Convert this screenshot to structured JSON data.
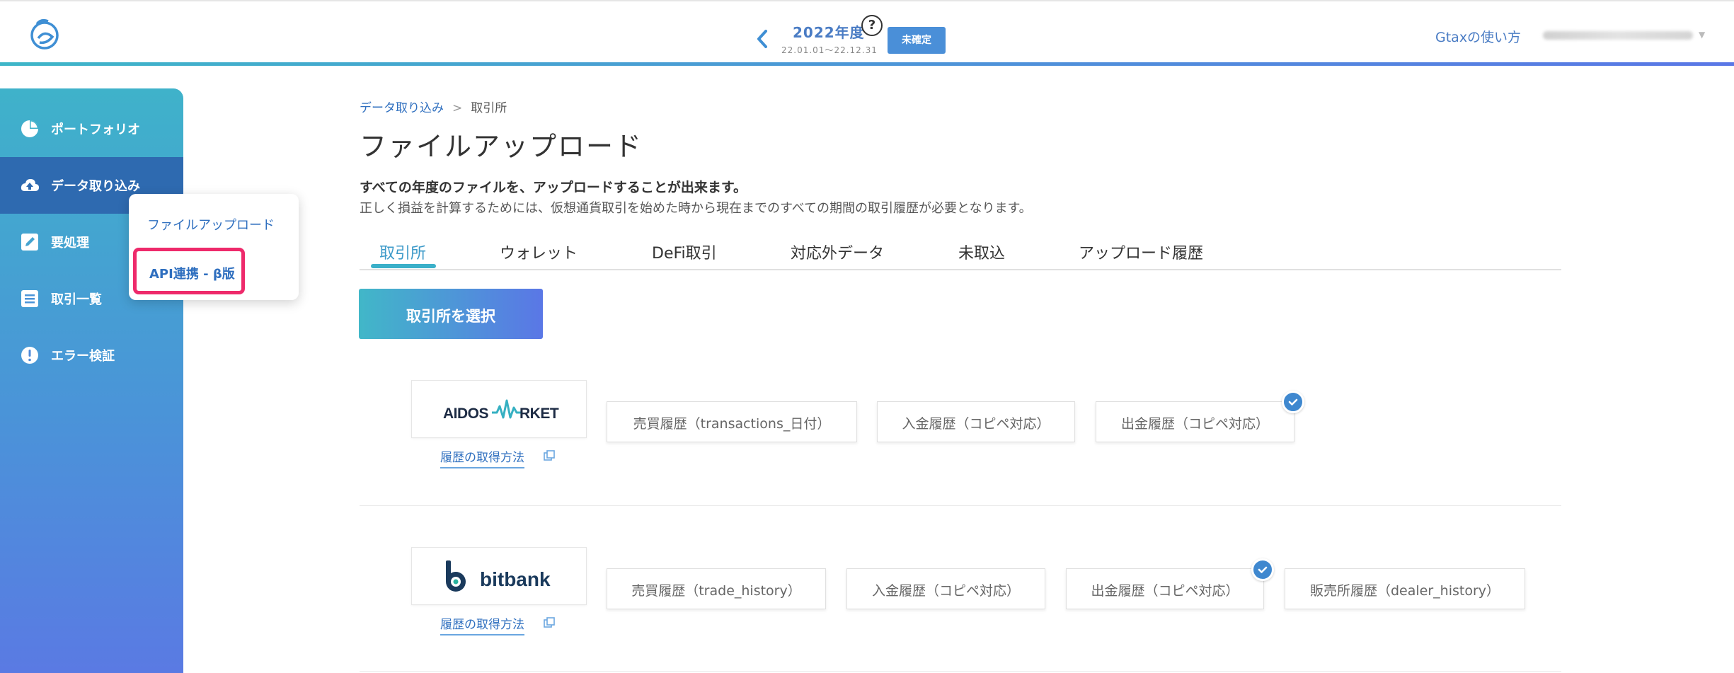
{
  "header": {
    "fiscal_year": "2022年度",
    "date_range": "22.01.01〜22.12.31",
    "help": "?",
    "status": "未確定",
    "howto_link": "Gtaxの使い方"
  },
  "sidebar": {
    "items": [
      {
        "label": "ポートフォリオ",
        "icon": "pie-chart-icon"
      },
      {
        "label": "データ取り込み",
        "icon": "cloud-upload-icon"
      },
      {
        "label": "要処理",
        "icon": "edit-icon"
      },
      {
        "label": "取引一覧",
        "icon": "list-icon"
      },
      {
        "label": "エラー検証",
        "icon": "alert-icon"
      }
    ]
  },
  "popover": {
    "items": [
      {
        "label": "ファイルアップロード"
      },
      {
        "label": "API連携 - β版"
      }
    ]
  },
  "breadcrumb": {
    "parent": "データ取り込み",
    "separator": ">",
    "current": "取引所"
  },
  "main": {
    "title": "ファイルアップロード",
    "desc1": "すべての年度のファイルを、アップロードすることが出来ます。",
    "desc2": "正しく損益を計算するためには、仮想通貨取引を始めた時から現在までのすべての期間の取引履歴が必要となります。",
    "tabs": [
      {
        "label": "取引所"
      },
      {
        "label": "ウォレット"
      },
      {
        "label": "DeFi取引"
      },
      {
        "label": "対応外データ"
      },
      {
        "label": "未取込"
      },
      {
        "label": "アップロード履歴"
      }
    ],
    "select_button": "取引所を選択",
    "exchanges": [
      {
        "logo_text": "AIDOSMARKET",
        "howto": "履歴の取得方法",
        "history": [
          {
            "label": "売買履歴（transactions_日付）",
            "checked": false
          },
          {
            "label": "入金履歴（コピペ対応）",
            "checked": false
          },
          {
            "label": "出金履歴（コピペ対応）",
            "checked": true
          }
        ]
      },
      {
        "logo_text": "bitbank",
        "howto": "履歴の取得方法",
        "history": [
          {
            "label": "売買履歴（trade_history）",
            "checked": false
          },
          {
            "label": "入金履歴（コピペ対応）",
            "checked": false
          },
          {
            "label": "出金履歴（コピペ対応）",
            "checked": true
          },
          {
            "label": "販売所履歴（dealer_history）",
            "checked": false
          }
        ]
      }
    ]
  },
  "colors": {
    "accent": "#4a7cc4",
    "gradient_start": "#3fb2ca",
    "gradient_end": "#5a77e6",
    "highlight": "#ee2a6b"
  }
}
